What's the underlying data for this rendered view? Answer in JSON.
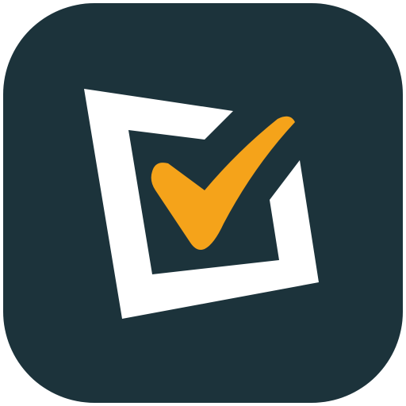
{
  "icon": {
    "name": "checkbox-check-app-icon",
    "glyph": "checked-box-icon",
    "colors": {
      "background": "#1c333b",
      "box": "#ffffff",
      "check": "#f5a31a"
    }
  }
}
